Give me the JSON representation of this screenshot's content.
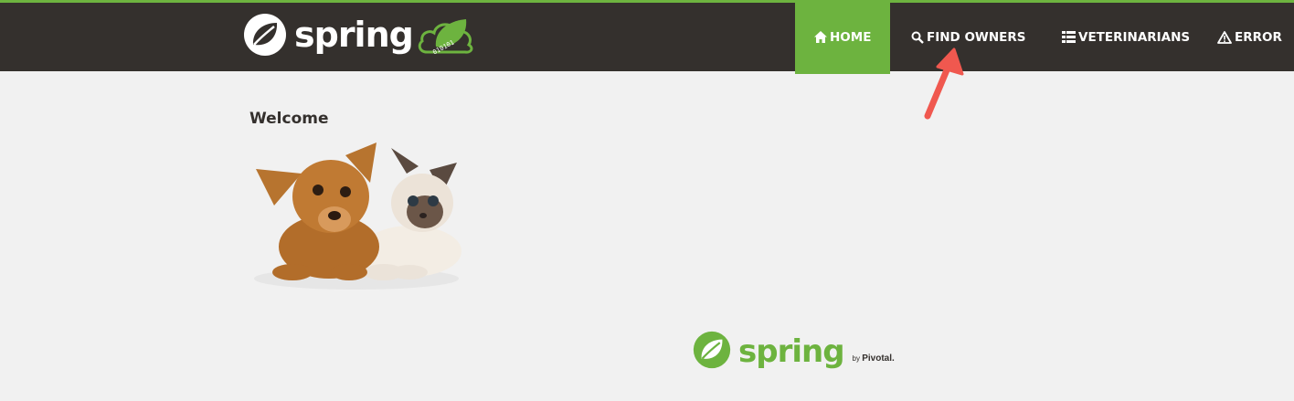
{
  "header": {
    "brand": {
      "wordmark": "spring",
      "cloud_text": "010101"
    },
    "nav": [
      {
        "label": "Home",
        "icon": "home-icon",
        "active": true
      },
      {
        "label": "Find owners",
        "icon": "search-icon",
        "active": false
      },
      {
        "label": "Veterinarians",
        "icon": "list-icon",
        "active": false
      },
      {
        "label": "Error",
        "icon": "warning-icon",
        "active": false
      }
    ]
  },
  "main": {
    "heading": "Welcome",
    "image": "pets-dog-and-cat"
  },
  "footer": {
    "wordmark": "spring",
    "by_prefix": "by",
    "by_name": "Pivotal."
  },
  "colors": {
    "header_bg": "#34302d",
    "accent_green": "#6db33f",
    "page_bg": "#f1f1f1",
    "annotation_arrow": "#f0584f"
  }
}
